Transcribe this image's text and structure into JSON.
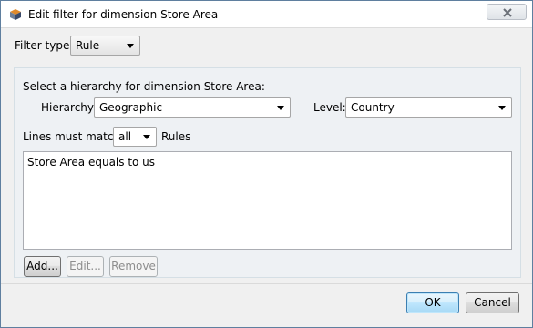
{
  "window": {
    "title": "Edit filter for dimension Store Area",
    "close_label": "Close"
  },
  "filter_type": {
    "label": "Filter type:",
    "value": "Rule"
  },
  "hierarchy_section": {
    "heading": "Select a hierarchy for dimension Store Area:",
    "hierarchy_label": "Hierarchy:",
    "hierarchy_value": "Geographic",
    "level_label": "Level:",
    "level_value": "Country"
  },
  "match": {
    "prefix": "Lines must match",
    "value": "all",
    "suffix": "Rules"
  },
  "rules": {
    "lines": [
      "Store Area equals to us"
    ]
  },
  "rule_buttons": {
    "add": "Add...",
    "edit": "Edit...",
    "remove": "Remove"
  },
  "dialog_buttons": {
    "ok": "OK",
    "cancel": "Cancel"
  }
}
